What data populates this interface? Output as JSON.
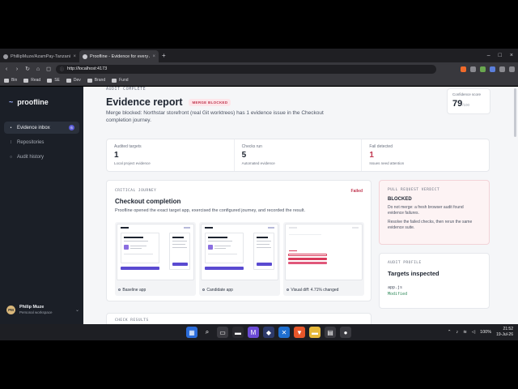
{
  "browser": {
    "tabs": [
      {
        "title": "PhillipMuze/AzamPay-Tanzania-Flutt",
        "active": false
      },
      {
        "title": "Proofline - Evidence for every AI",
        "active": true
      }
    ],
    "url": "http://localhost:4173",
    "bookmarks": [
      "Bin",
      "Read",
      "SE",
      "Dev",
      "Brand",
      "Fund"
    ]
  },
  "sidebar": {
    "brand": "proofline",
    "items": [
      {
        "label": "Evidence inbox",
        "icon": "dot-icon",
        "badge": "6",
        "active": true
      },
      {
        "label": "Repositories",
        "icon": "repo-icon",
        "active": false
      },
      {
        "label": "Audit history",
        "icon": "circle-icon",
        "active": false
      }
    ],
    "user": {
      "initials": "PM",
      "name": "Philip Muze",
      "workspace": "Personal workspace"
    }
  },
  "report": {
    "eyebrow": "AUDIT COMPLETE",
    "title": "Evidence report",
    "status_pill": "MERGE BLOCKED",
    "subtitle": "Merge blocked: Northstar storefront (real Git worktrees) has 1 evidence issue in the Checkout completion journey.",
    "confidence": {
      "label": "Confidence score",
      "value": "79",
      "suffix": "/100"
    }
  },
  "stats": [
    {
      "label": "Audited targets",
      "value": "1",
      "caption": "Local project evidence"
    },
    {
      "label": "Checks run",
      "value": "5",
      "caption": "Automated evidence"
    },
    {
      "label": "Fail detected",
      "value": "1",
      "caption": "Issues need attention"
    }
  ],
  "journey": {
    "eyebrow": "CRITICAL JOURNEY",
    "status": "Failed",
    "title": "Checkout completion",
    "description": "Proofline opened the exact target app, exercised the configured journey, and recorded the result.",
    "shots": [
      {
        "caption": "Baseline app"
      },
      {
        "caption": "Candidate app"
      },
      {
        "caption": "Visual diff: 4.71% changed"
      }
    ]
  },
  "checks": {
    "eyebrow": "CHECK RESULTS"
  },
  "verdict": {
    "eyebrow": "PULL REQUEST VERDICT",
    "title": "BLOCKED",
    "line1": "Do not merge: a fresh browser audit found evidence failures.",
    "line2": "Resolve the failed checks, then rerun the same evidence suite."
  },
  "profile": {
    "eyebrow": "AUDIT PROFILE",
    "title": "Targets inspected",
    "code1": "app.js",
    "code2": "Modified"
  },
  "taskbar": {
    "battery": "100%",
    "time": "21:52",
    "date": "19-Jul-26"
  }
}
